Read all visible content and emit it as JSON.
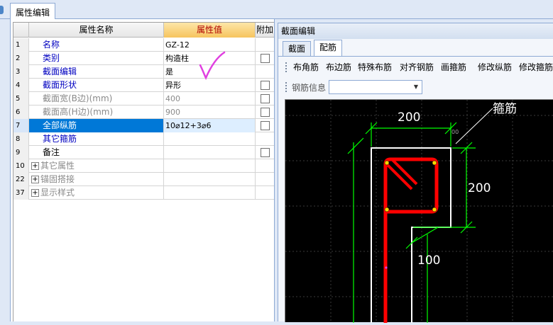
{
  "main_tab": "属性编辑",
  "grid": {
    "headers": {
      "name": "属性名称",
      "value": "属性值",
      "extra": "附加"
    },
    "rows": [
      {
        "num": "1",
        "name": "名称",
        "value": "GZ-12",
        "checkbox": false
      },
      {
        "num": "2",
        "name": "类别",
        "value": "构造柱",
        "checkbox": true
      },
      {
        "num": "3",
        "name": "截面编辑",
        "value": "是",
        "checkbox": false
      },
      {
        "num": "4",
        "name": "截面形状",
        "value": "异形",
        "checkbox": true
      },
      {
        "num": "5",
        "name": "截面宽(B边)(mm)",
        "value": "400",
        "checkbox": true
      },
      {
        "num": "6",
        "name": "截面高(H边)(mm)",
        "value": "900",
        "checkbox": true
      },
      {
        "num": "7",
        "name": "全部纵筋",
        "value": "10⌀12+3⌀6",
        "checkbox": true
      },
      {
        "num": "8",
        "name": "其它箍筋",
        "value": "",
        "checkbox": false
      },
      {
        "num": "9",
        "name": "备注",
        "value": "",
        "checkbox": true
      },
      {
        "num": "10",
        "name": "其它属性",
        "group": true
      },
      {
        "num": "22",
        "name": "锚固搭接",
        "group": true
      },
      {
        "num": "37",
        "name": "显示样式",
        "group": true
      }
    ]
  },
  "section_panel": {
    "title": "截面编辑",
    "tabs": [
      "截面",
      "配筋"
    ],
    "toolbar": [
      "布角筋",
      "布边筋",
      "特殊布筋",
      "对齐钢筋",
      "画箍筋",
      "修改纵筋",
      "修改箍筋"
    ],
    "rebar_info_label": "钢筋信息",
    "rebar_info_value": "",
    "drawing": {
      "dims": {
        "top": "200",
        "right": "200",
        "middle": "100"
      },
      "leader_label": "箍筋",
      "tag": "00"
    }
  },
  "colors": {
    "accent": "#0078d7",
    "canvas_bg": "#000000",
    "dimension": "#00ff00",
    "rebar": "#ff0000",
    "annotation": "#e040e0"
  }
}
